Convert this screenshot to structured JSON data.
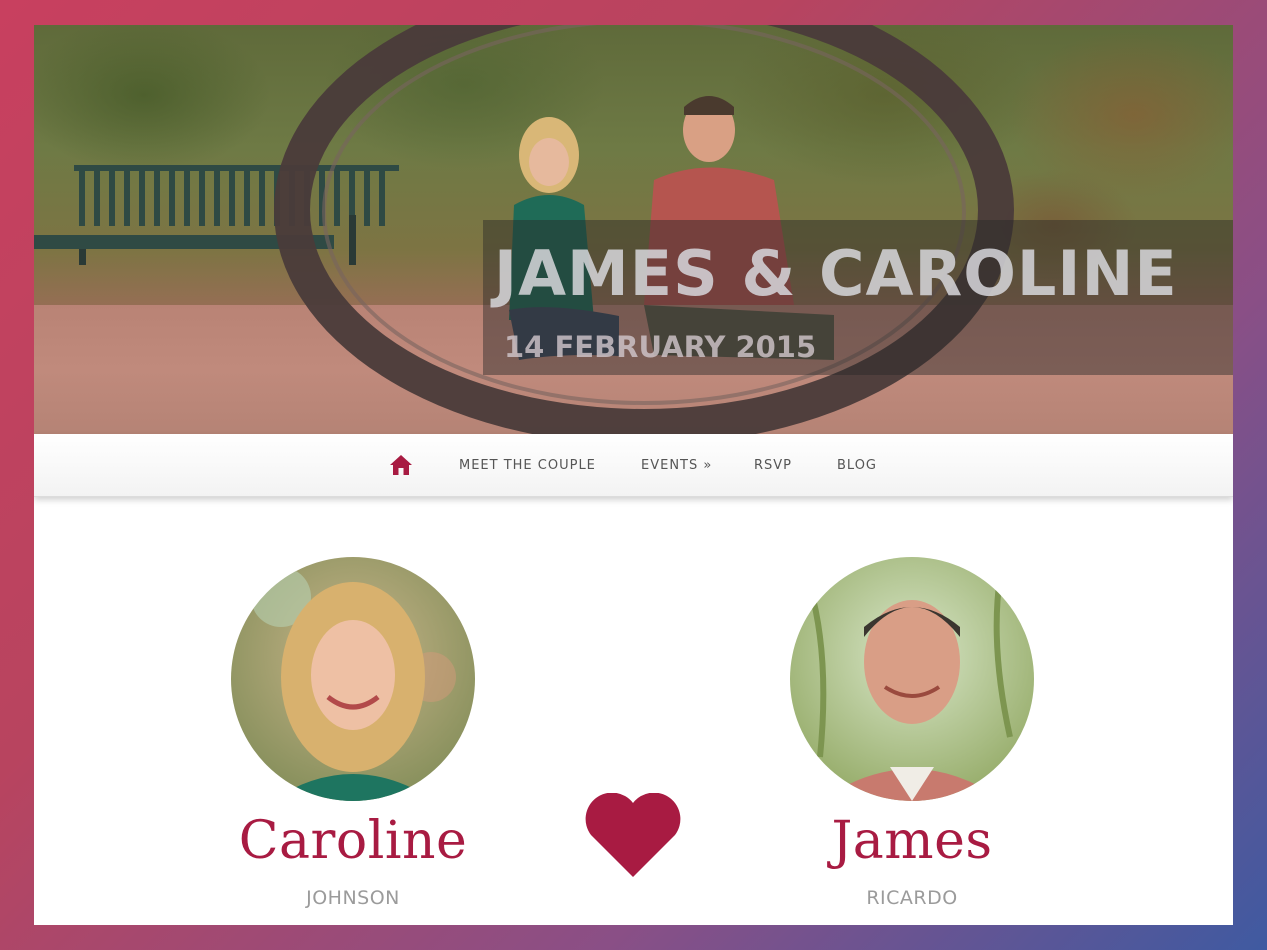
{
  "hero": {
    "title": "JAMES & CAROLINE",
    "date": "14 FEBRUARY 2015"
  },
  "nav": {
    "home_icon": "home-icon",
    "items": [
      {
        "label": "MEET THE COUPLE"
      },
      {
        "label": "EVENTS »"
      },
      {
        "label": "RSVP"
      },
      {
        "label": "BLOG"
      }
    ]
  },
  "couple": {
    "bride": {
      "first_name": "Caroline",
      "last_name": "JOHNSON"
    },
    "groom": {
      "first_name": "James",
      "last_name": "RICARDO"
    },
    "divider_icon": "heart-icon"
  },
  "colors": {
    "accent": "#a81b42",
    "nav_text": "#555555",
    "surname_text": "#9b9b9b"
  }
}
